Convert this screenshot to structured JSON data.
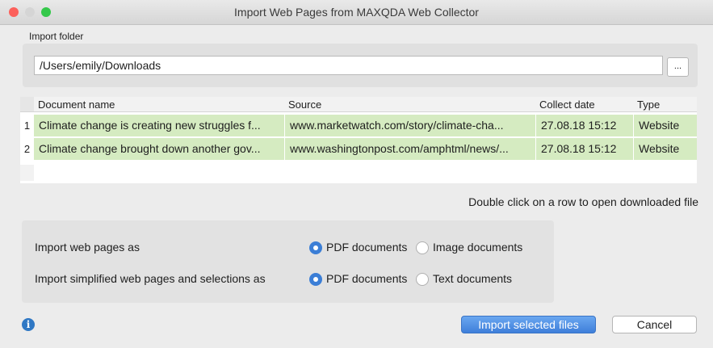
{
  "window": {
    "title": "Import Web Pages from MAXQDA Web Collector",
    "traffic_lights": [
      "#fc605b",
      "#d5d5d5",
      "#34c84a"
    ]
  },
  "folder": {
    "label": "Import folder",
    "path": "/Users/emily/Downloads",
    "browse_label": "..."
  },
  "table": {
    "columns": [
      "Document name",
      "Source",
      "Collect date",
      "Type"
    ],
    "rows": [
      {
        "num": "1",
        "name": "Climate change is creating new struggles f...",
        "source": "www.marketwatch.com/story/climate-cha...",
        "date": "27.08.18 15:12",
        "type": "Website"
      },
      {
        "num": "2",
        "name": "Climate change brought down another gov...",
        "source": "www.washingtonpost.com/amphtml/news/...",
        "date": "27.08.18 15:12",
        "type": "Website"
      }
    ],
    "row_color": "#d5ebc1"
  },
  "hint": "Double click on a row to open downloaded file",
  "options": {
    "web_pages": {
      "label": "Import web pages as",
      "choice1": "PDF documents",
      "choice2": "Image documents",
      "selected": "PDF documents"
    },
    "simplified": {
      "label": "Import simplified web pages and selections as",
      "choice1": "PDF documents",
      "choice2": "Text documents",
      "selected": "PDF documents"
    }
  },
  "footer": {
    "info_icon": "info-icon",
    "import_label": "Import selected files",
    "cancel_label": "Cancel",
    "accent": "#3f7fda"
  }
}
